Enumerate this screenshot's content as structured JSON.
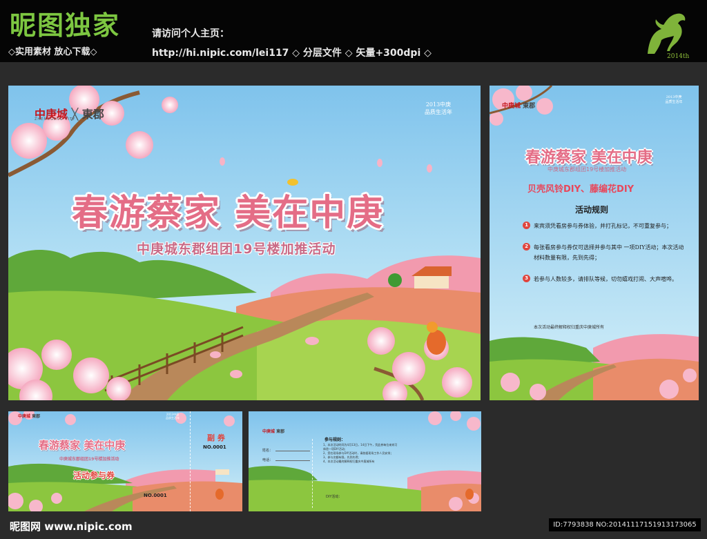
{
  "header": {
    "brand_title": "昵图独家",
    "brand_tagline": "◇实用素材 放心下载◇",
    "visit_label": "请访问个人主页：",
    "homepage_line": "http://hi.nipic.com/lei117 ◇ 分层文件 ◇ 矢量+300dpi ◇",
    "logo_year": "2014th"
  },
  "poster": {
    "company_logo": "中庚城",
    "company_logo_en": "ZHENGGENG CITY",
    "district": "東郡",
    "badge_line1": "2013中庚",
    "badge_line2": "品质生活年",
    "title": "春游蔡家 美在中庚",
    "subtitle": "中庚城东郡组团19号楼加推活动"
  },
  "flyer": {
    "company_logo": "中庚城",
    "district": "東郡",
    "badge_line1": "2013中庚",
    "badge_line2": "品质生活年",
    "title": "春游蔡家 美在中庚",
    "subtitle": "中庚城东郡组团19号楼加推活动",
    "activity": "贝壳风铃DIY、藤编花DIY",
    "rules_heading": "活动规则",
    "rules": [
      {
        "num": "1",
        "text": "来宾须凭看房参与券体验，并打孔标记，不可重复参与；"
      },
      {
        "num": "2",
        "text": "每张看房参与券仅可选择并参与其中 一项DIY活动；本次活动材料数量有限，先到先得；"
      },
      {
        "num": "3",
        "text": "若参与人数较多，请排队等候，切勿嬉戏打闹、大声喧哗。"
      }
    ],
    "footnote": "本次活动最终解释权归重庆中庚城所有"
  },
  "ticket_front": {
    "company_logo": "中庚城",
    "district": "東郡",
    "badge_line1": "2013中庚",
    "badge_line2": "品质生活年",
    "title": "春游蔡家 美在中庚",
    "subtitle": "中庚城东郡组团19号楼加推活动",
    "coupon_label": "活动参与券",
    "number": "NO.0001",
    "stub_label": "副 券",
    "stub_number": "NO.0001"
  },
  "ticket_back": {
    "company_logo": "中庚城",
    "district": "東郡",
    "form_name": "姓名：",
    "form_phone": "电话：",
    "rules_heading": "参与规则：",
    "rules": [
      "1、本次活动时间为4月13日，14日下午，凭此券每位来宾可",
      "   体验一项DIY活动；",
      "2、您在现场参与DIY活动时，请依据现场工作人员安排；",
      "3、参与名额有限，先到先得；",
      "4、本次活动最终解释权归重庆中庚城所有"
    ],
    "diy_label": "DIY活动："
  },
  "footer": {
    "brand": "昵图网 www.nipic.com",
    "image_id": "ID:7793838 NO:20141117151913173065"
  },
  "colors": {
    "sky_top": "#7fc3ec",
    "sky_bottom": "#bfe6f6",
    "grass": "#8cc63f",
    "title_pink": "#e46d86",
    "accent_red": "#e0453e",
    "brand_green": "#7dc741"
  }
}
